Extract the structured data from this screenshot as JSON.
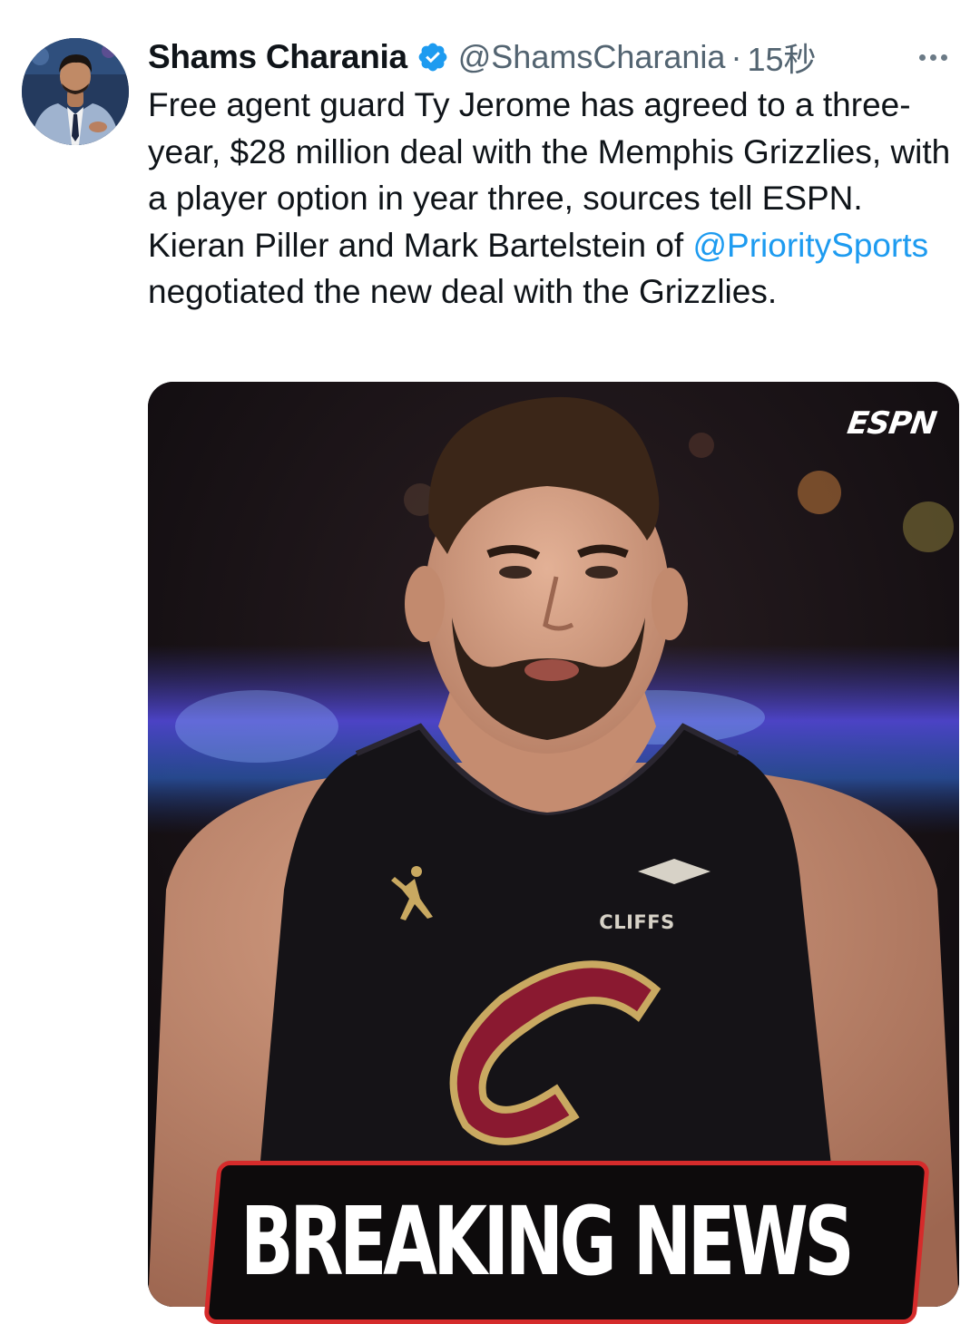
{
  "tweet": {
    "author": {
      "display_name": "Shams Charania",
      "handle": "@ShamsCharania",
      "verified": true
    },
    "separator": "·",
    "timestamp": "15秒",
    "text_segments": [
      "Free agent guard Ty Jerome has agreed to a three-year, $28 million deal with the Memphis Grizzlies, with a player option in year three, sources tell ESPN. Kieran Piller and Mark Bartelstein of ",
      "@PrioritySports",
      " negotiated the new deal with the Grizzlies."
    ],
    "media": {
      "logo_text": "ESPN",
      "jersey_sponsor": "CLIFFS",
      "banner_text": "BREAKING NEWS"
    }
  },
  "colors": {
    "text_primary": "#0f1419",
    "text_secondary": "#536471",
    "link": "#1d9bf0",
    "verified_badge": "#1d9bf0",
    "banner_border": "#d52b2b"
  },
  "icons": {
    "verified": "verified-badge-icon",
    "more": "more-horizontal-icon"
  }
}
